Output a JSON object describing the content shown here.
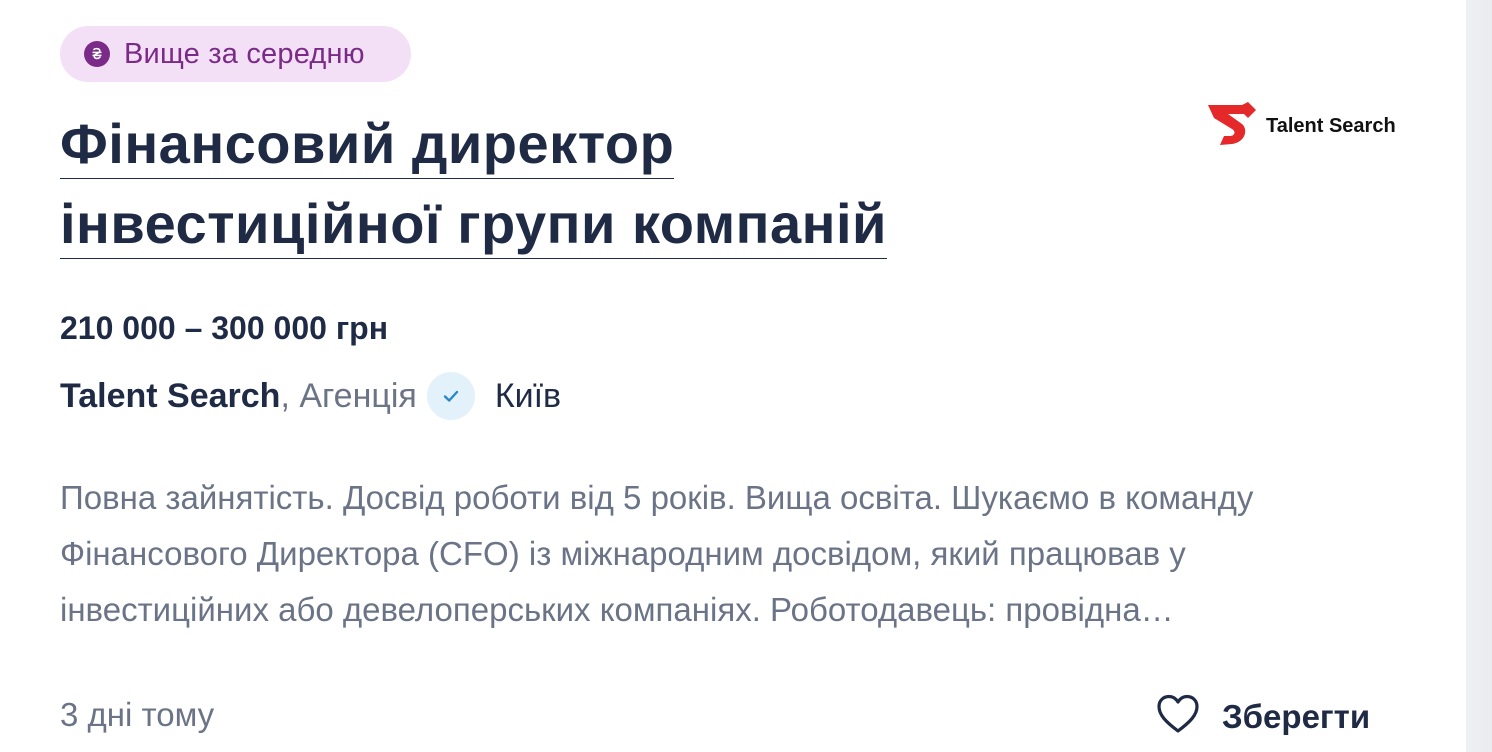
{
  "badge": {
    "label": "Вище за середню",
    "icon": "hryvnia-icon"
  },
  "job": {
    "title_line1": "Фінансовий директор",
    "title_line2": "інвестиційної групи компаній",
    "salary": "210 000 – 300 000 грн",
    "company": "Talent Search",
    "company_type": ", Агенція",
    "city": "Київ",
    "description": "Повна зайнятість. Досвід роботи від 5 років. Вища освіта. Шукаємо в команду Фінансового Директора (CFO) із міжнародним досвідом, який працював у інвестиційних або девелоперських компаніях. Роботодавець: провідна…",
    "posted": "3 дні тому"
  },
  "logo": {
    "text": "Talent Search",
    "icon": "talent-search-logo-icon"
  },
  "actions": {
    "save_label": "Зберегти",
    "save_icon": "heart-icon"
  },
  "colors": {
    "badge_bg": "#f4e0f6",
    "badge_fg": "#7a2b87",
    "heading": "#1f2a44",
    "muted": "#6b7487",
    "verified_bg": "#e3f1fb",
    "verified_fg": "#2b87c8",
    "logo_red": "#e5282a"
  }
}
